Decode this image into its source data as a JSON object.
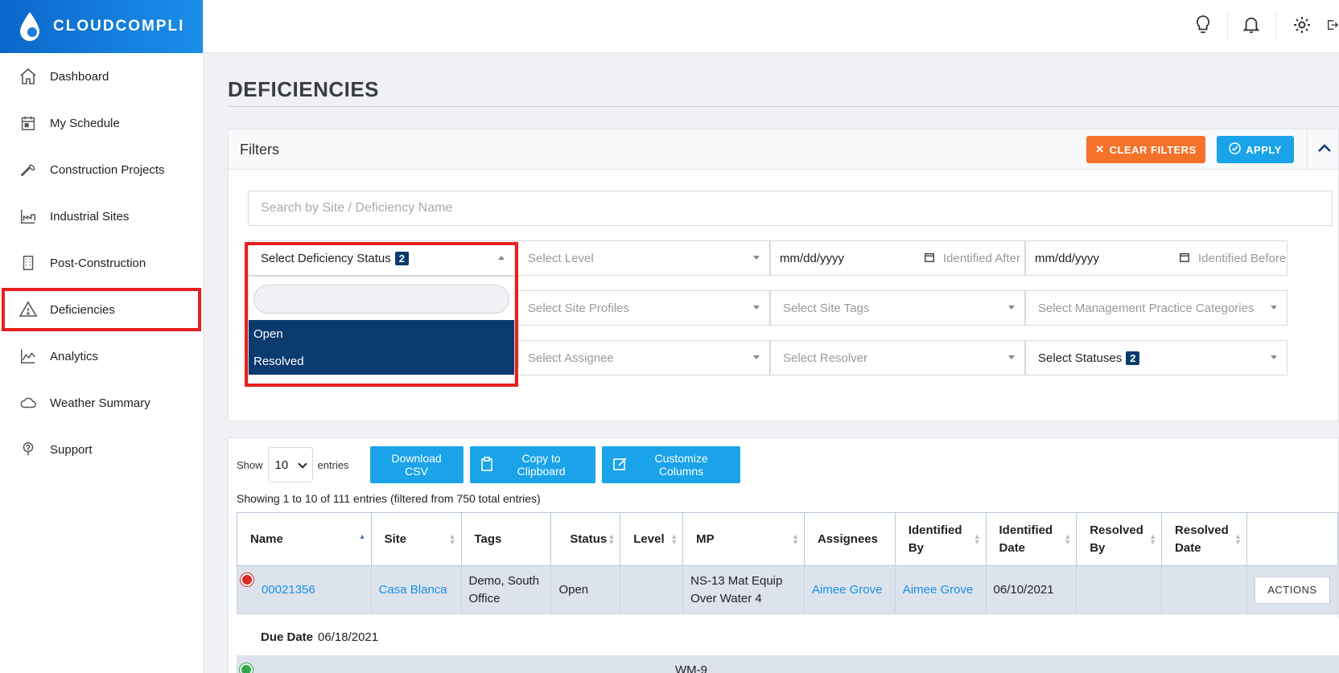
{
  "app": {
    "brand": "CLOUDCOMPLI"
  },
  "sidebar": {
    "items": [
      {
        "label": "Dashboard",
        "icon": "home-icon"
      },
      {
        "label": "My Schedule",
        "icon": "calendar-icon"
      },
      {
        "label": "Construction Projects",
        "icon": "wrench-icon"
      },
      {
        "label": "Industrial Sites",
        "icon": "factory-icon"
      },
      {
        "label": "Post-Construction",
        "icon": "building-icon"
      },
      {
        "label": "Deficiencies",
        "icon": "warning-icon"
      },
      {
        "label": "Analytics",
        "icon": "area-chart-icon"
      },
      {
        "label": "Weather Summary",
        "icon": "cloud-icon"
      },
      {
        "label": "Support",
        "icon": "question-icon"
      }
    ]
  },
  "page": {
    "title": "DEFICIENCIES"
  },
  "filters": {
    "title": "Filters",
    "clear_label": "CLEAR FILTERS",
    "apply_label": "APPLY",
    "search_placeholder": "Search by Site / Deficiency Name",
    "deficiency_status": {
      "label": "Select Deficiency Status",
      "count": "2",
      "options": [
        "Open",
        "Resolved"
      ]
    },
    "level": "Select Level",
    "date_after": {
      "value": "mm/dd/yyyy",
      "label": "Identified After"
    },
    "date_before": {
      "value": "mm/dd/yyyy",
      "label": "Identified Before"
    },
    "site_profiles": "Select Site Profiles",
    "site_tags": "Select Site Tags",
    "mp_categories": "Select Management Practice Categories",
    "assignee": "Select Assignee",
    "resolver": "Select Resolver",
    "statuses": {
      "label": "Select Statuses",
      "count": "2"
    }
  },
  "table": {
    "show_label": "Show",
    "entries_value": "10",
    "entries_label": "entries",
    "download_label": "Download CSV",
    "copy_label": "Copy to Clipboard",
    "customize_label": "Customize Columns",
    "showing_text": "Showing 1 to 10 of 111 entries (filtered from 750 total entries)",
    "columns": [
      "Name",
      "Site",
      "Tags",
      "Status",
      "Level",
      "MP",
      "Assignees",
      "Identified By",
      "Identified Date",
      "Resolved By",
      "Resolved Date",
      ""
    ],
    "rows": [
      {
        "name": "00021356",
        "site": "Casa Blanca",
        "tags": "Demo, South Office",
        "status": "Open",
        "level": "",
        "mp": "NS-13 Mat Equip Over Water 4",
        "assignees": "Aimee Grove",
        "identified_by": "Aimee Grove",
        "identified_date": "06/10/2021",
        "resolved_by": "",
        "resolved_date": "",
        "actions_label": "ACTIONS",
        "due_date_label": "Due Date",
        "due_date": "06/18/2021"
      }
    ],
    "next_row_mp": "WM-9"
  },
  "colors": {
    "accent": "#1aa3e8",
    "clear": "#f5722a",
    "highlight": "#e8201e",
    "navy": "#0b3a6e"
  }
}
